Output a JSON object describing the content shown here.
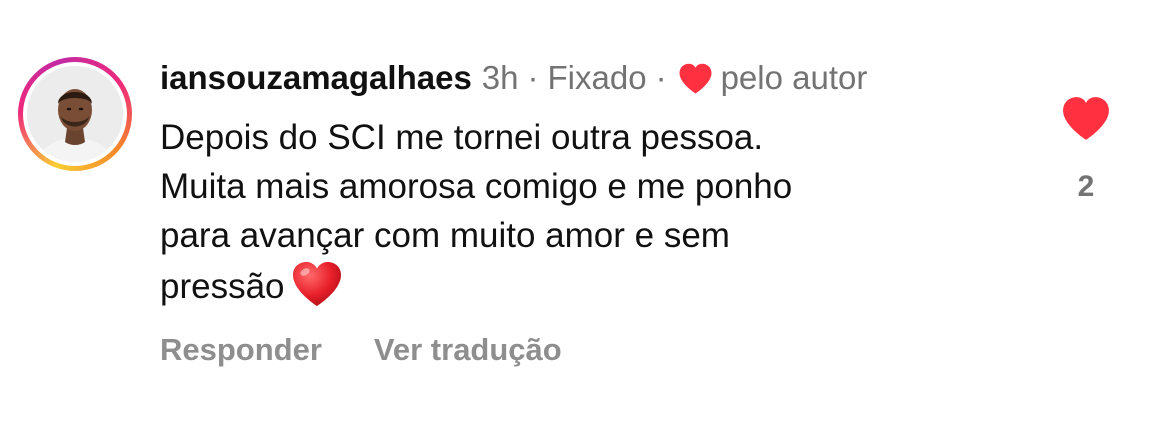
{
  "comment": {
    "username": "iansouzamagalhaes",
    "time": "3h",
    "separator": "·",
    "pinned_label": "Fixado",
    "liked_by_label": "pelo autor",
    "text_lines": [
      "Depois do SCI me tornei outra pessoa.",
      "Muita mais amorosa comigo e me ponho",
      "para avançar com muito amor e sem",
      "pressão"
    ],
    "emoji": "heart-emoji",
    "reply_label": "Responder",
    "translate_label": "Ver tradução",
    "like_count": "2"
  },
  "colors": {
    "heart_red": "#ff3040",
    "muted_text": "#737373",
    "action_text": "#8e8e8e"
  },
  "icons": {
    "author_like": "heart-icon",
    "like_button": "heart-icon",
    "avatar": "avatar-photo"
  }
}
